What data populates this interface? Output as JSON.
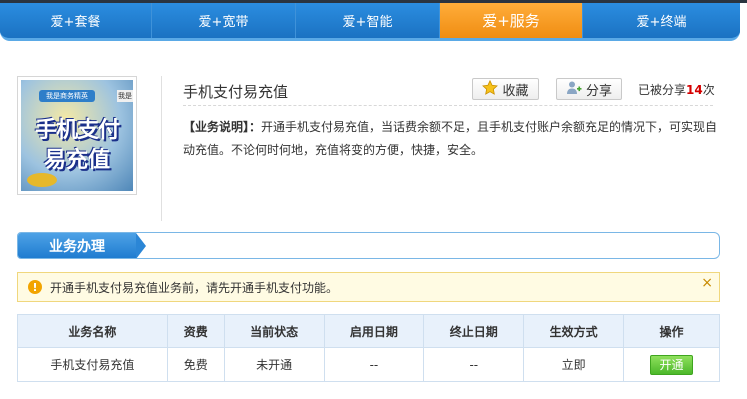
{
  "topnav": {
    "tabs": [
      {
        "label": "爱+套餐"
      },
      {
        "label": "爱+宽带"
      },
      {
        "label": "爱+智能"
      },
      {
        "label": "爱+服务"
      },
      {
        "label": "爱+终端"
      }
    ],
    "active_index": 3,
    "colors": {
      "tab_blue": "#1f7fd0",
      "tab_active_orange": "#f39a1e"
    }
  },
  "product": {
    "image_text": {
      "badge": "我是商务精英",
      "corner": "我是",
      "line1": "手机支付",
      "line2": "易充值"
    },
    "title": "手机支付易充值",
    "favorite_label": "收藏",
    "favorite_icon": "star-icon",
    "share_label": "分享",
    "share_icon": "add-user-icon",
    "share_prefix": "已被分享",
    "share_count": "14",
    "share_suffix": "次",
    "desc_key": "【业务说明】：",
    "desc_text": "开通手机支付易充值，当话费余额不足，且手机支付账户余额充足的情况下，可实现自动充值。不论何时何地，充值将变的方便，快捷，安全。"
  },
  "section": {
    "tab_label": "业务办理"
  },
  "notice": {
    "icon": "warning-icon",
    "text": "开通手机支付易充值业务前，请先开通手机支付功能。",
    "close": "×"
  },
  "table": {
    "headers": [
      "业务名称",
      "资费",
      "当前状态",
      "启用日期",
      "终止日期",
      "生效方式",
      "操作"
    ],
    "rows": [
      {
        "name": "手机支付易充值",
        "fee": "免费",
        "status": "未开通",
        "start": "--",
        "end": "--",
        "mode": "立即",
        "action": "开通"
      }
    ]
  }
}
